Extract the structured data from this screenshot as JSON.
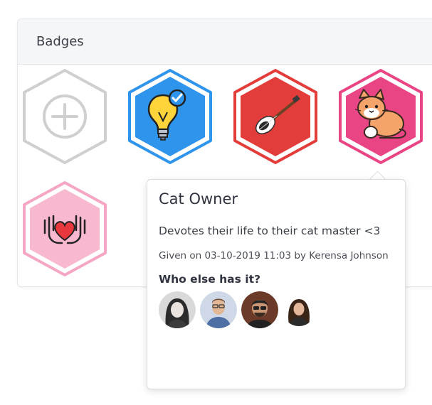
{
  "card": {
    "title": "Badges"
  },
  "badges": [
    {
      "icon": "add-badge-icon",
      "label": "Add badge"
    },
    {
      "icon": "lightbulb-check-icon"
    },
    {
      "icon": "guitar-icon"
    },
    {
      "icon": "cat-icon"
    },
    {
      "icon": "hands-heart-icon"
    }
  ],
  "tooltip": {
    "title": "Cat Owner",
    "description": "Devotes their life to their cat master <3",
    "given": "Given on 03-10-2019 11:03 by Kerensa Johnson",
    "who_else_label": "Who else has it?",
    "avatars": [
      "avatar-1",
      "avatar-2",
      "avatar-3",
      "avatar-4"
    ]
  },
  "colors": {
    "add_badge": "#cfcfcf",
    "lightbulb_badge": "#2f95ec",
    "guitar_badge": "#e23d3a",
    "cat_badge": "#e94585",
    "hands_badge": "#f4a6c4"
  }
}
